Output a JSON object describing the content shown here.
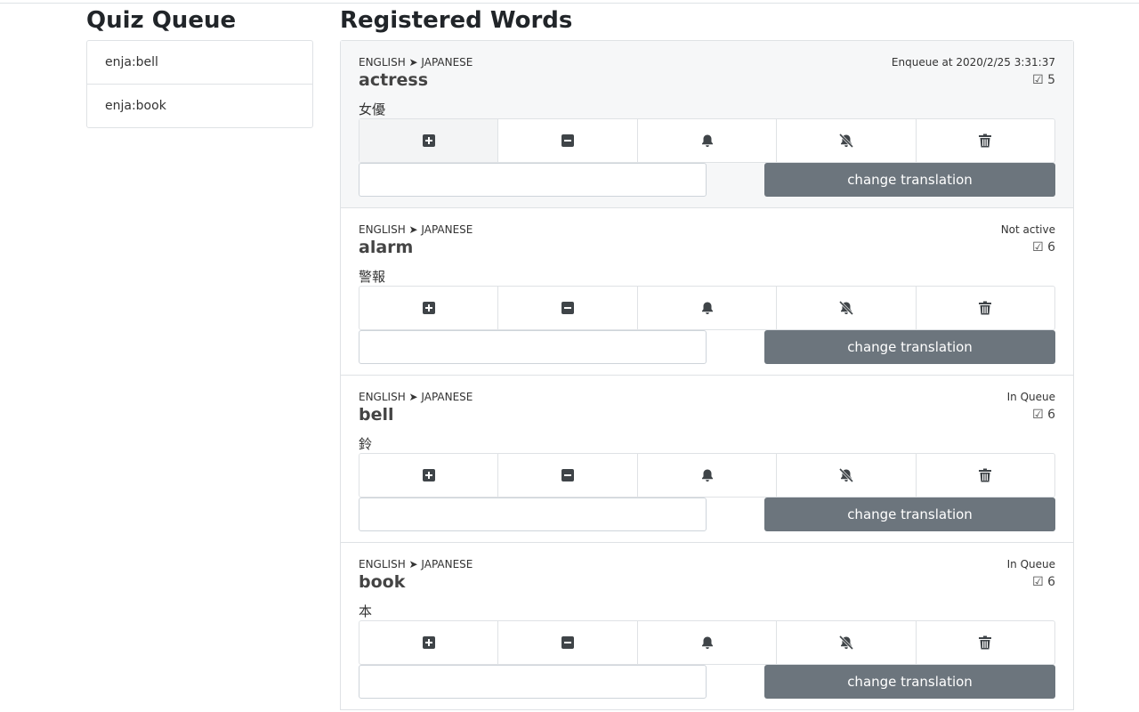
{
  "queue": {
    "title": "Quiz Queue",
    "items": [
      {
        "label": "enja:bell"
      },
      {
        "label": "enja:book"
      }
    ]
  },
  "words": {
    "title": "Registered Words",
    "items": [
      {
        "lang": "ENGLISH ➤ JAPANESE",
        "word": "actress",
        "translation": "女優",
        "status": "Enqueue at 2020/2/25 3:31:37",
        "count": "☑ 5",
        "button_label": "change translation"
      },
      {
        "lang": "ENGLISH ➤ JAPANESE",
        "word": "alarm",
        "translation": "警報",
        "status": "Not active",
        "count": "☑ 6",
        "button_label": "change translation"
      },
      {
        "lang": "ENGLISH ➤ JAPANESE",
        "word": "bell",
        "translation": "鈴",
        "status": "In Queue",
        "count": "☑ 6",
        "button_label": "change translation"
      },
      {
        "lang": "ENGLISH ➤ JAPANESE",
        "word": "book",
        "translation": "本",
        "status": "In Queue",
        "count": "☑ 6",
        "button_label": "change translation"
      }
    ],
    "icons": [
      "plus-square-icon",
      "minus-square-icon",
      "bell-icon",
      "bell-slash-icon",
      "trash-icon"
    ]
  },
  "colors": {
    "button_bg": "#6c757d",
    "active_card_bg": "#f6f7f8",
    "icon": "#3f4448"
  }
}
